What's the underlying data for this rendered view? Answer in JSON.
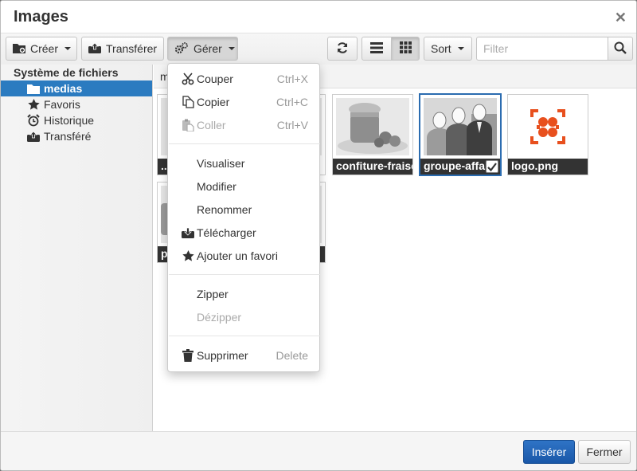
{
  "window": {
    "title": "Images",
    "close_icon": "close-icon"
  },
  "toolbar": {
    "create_label": "Créer",
    "upload_label": "Transférer",
    "manage_label": "Gérer",
    "sort_label": "Sort",
    "filter_placeholder": "Filter"
  },
  "sidebar": {
    "root_label": "Système de fichiers",
    "items": [
      {
        "label": "medias",
        "icon": "folder-icon",
        "selected": true
      },
      {
        "label": "Favoris",
        "icon": "star-icon",
        "selected": false
      },
      {
        "label": "Historique",
        "icon": "alarm-clock-icon",
        "selected": false
      },
      {
        "label": "Transféré",
        "icon": "upload-icon",
        "selected": false
      }
    ]
  },
  "path": {
    "text": "m"
  },
  "thumbnails": [
    {
      "caption": "...",
      "kind": "photo"
    },
    {
      "caption": "confiture-fraise-",
      "kind": "photo"
    },
    {
      "caption": "groupe-affai",
      "kind": "photo",
      "selected": true
    },
    {
      "caption": "logo.png",
      "kind": "logo"
    },
    {
      "caption": "p",
      "kind": "photo"
    }
  ],
  "context_menu": {
    "cut": {
      "label": "Couper",
      "shortcut": "Ctrl+X"
    },
    "copy": {
      "label": "Copier",
      "shortcut": "Ctrl+C"
    },
    "paste": {
      "label": "Coller",
      "shortcut": "Ctrl+V"
    },
    "view": {
      "label": "Visualiser"
    },
    "edit": {
      "label": "Modifier"
    },
    "rename": {
      "label": "Renommer"
    },
    "download": {
      "label": "Télécharger"
    },
    "favorite": {
      "label": "Ajouter un favori"
    },
    "zip": {
      "label": "Zipper"
    },
    "unzip": {
      "label": "Dézipper"
    },
    "delete": {
      "label": "Supprimer",
      "shortcut": "Delete"
    }
  },
  "footer": {
    "insert_label": "Insérer",
    "close_label": "Fermer"
  },
  "colors": {
    "accent": "#2b7bc0",
    "primary_button": "#1f5fb0",
    "logo_orange": "#e8501e"
  }
}
